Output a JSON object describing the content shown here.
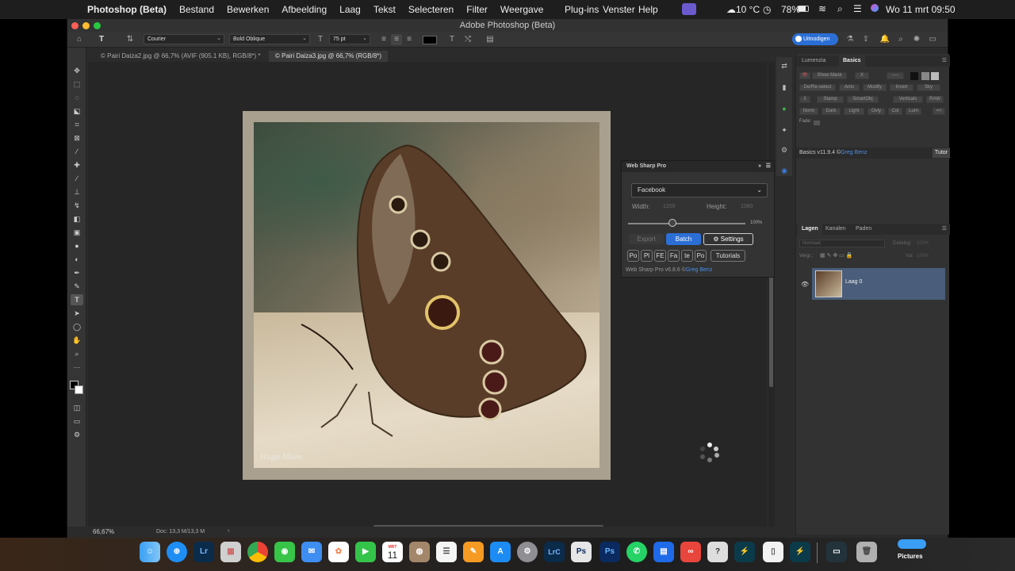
{
  "menubar": {
    "app_name": "Photoshop (Beta)",
    "items": [
      "Bestand",
      "Bewerken",
      "Afbeelding",
      "Laag",
      "Tekst",
      "Selecteren",
      "Filter",
      "Weergave"
    ],
    "right_items": [
      "Plug-ins",
      "Venster",
      "Help"
    ],
    "temperature": "10 °C",
    "battery": "78%",
    "clock": "Wo 11 mrt 09:50"
  },
  "window": {
    "title": "Adobe Photoshop (Beta)",
    "share_button": "Uitnodigen"
  },
  "options_bar": {
    "font_family": "Courier",
    "font_style": "Bold Oblique",
    "font_size": "75 pt"
  },
  "document_tabs": [
    {
      "label": "© Pairi Daiza2.jpg @ 66,7% (AVIF (905.1 KB), RGB/8*) *"
    },
    {
      "label": "© Pairi Daiza3.jpg @ 66,7% (RGB/8*)"
    }
  ],
  "canvas": {
    "watermark": "Hugo Maes"
  },
  "status_bar": {
    "zoom": "66,67%",
    "doc_info": "Doc: 13,3 M/13,3 M"
  },
  "basics_panel": {
    "tabs": [
      "Lumenzia",
      "Basics"
    ],
    "row1": [
      "Show Mask",
      "X",
      "----"
    ],
    "row2": [
      "De/Re-select",
      "Ants",
      "Modify",
      "Invert",
      "Sky"
    ],
    "row3": [
      "Stamp",
      "SmartObj",
      "Verticals",
      "RAW"
    ],
    "row4": [
      "Norm",
      "Dark",
      "Light",
      "Ovly",
      "Col",
      "Lum"
    ],
    "fade_label": "Fade:",
    "version_prefix": "Basics v11.9.4 ©",
    "author": "Greg Benz",
    "tutorials_button": "Tutor"
  },
  "web_sharp_pro": {
    "title": "Web Sharp Pro",
    "preset": "Facebook",
    "width_label": "Width:",
    "width_value": "1200",
    "height_label": "Height:",
    "height_value": "1080",
    "slider_percent": "100%",
    "slider_value": 0.38,
    "export_button": "Export",
    "batch_button": "Batch",
    "settings_button": "Settings",
    "small_buttons": [
      "Po",
      "Pl",
      "FE",
      "Fa",
      "te",
      "Po"
    ],
    "tutorials_button": "Tutorials",
    "version_prefix": "Web Sharp Pro v6.8.6 ©",
    "author": "Greg Benz"
  },
  "layers_panel": {
    "tabs": [
      "Lagen",
      "Kanalen",
      "Paden"
    ],
    "blend_mode": "Normaal",
    "opacity_label": "Dekking:",
    "opacity_value": "100%",
    "lock_label": "Vergr.:",
    "fill_label": "Vul:",
    "fill_value": "100%",
    "layer_name": "Laag 0"
  },
  "dock": {
    "calendar_month": "MRT",
    "calendar_day": "11",
    "apps": [
      "Finder",
      "Safari",
      "Lightroom",
      "Launchpad",
      "Chrome",
      "Berichten",
      "Mail",
      "Foto's",
      "FaceTime",
      "Agenda",
      "Notities",
      "Herinneringen",
      "Pages",
      "App Store",
      "Systeeminstellingen",
      "Lightroom Classic",
      "Photoshop (Beta)",
      "Photoshop",
      "WhatsApp",
      "Keynote",
      "Creative Cloud",
      "Preview",
      "Affinity",
      "Document",
      "Downloads"
    ],
    "folder_label": "Pictures"
  },
  "colors": {
    "accent_blue": "#2b6fd6",
    "panel_bg": "#323232",
    "canvas_bg": "#262626"
  }
}
